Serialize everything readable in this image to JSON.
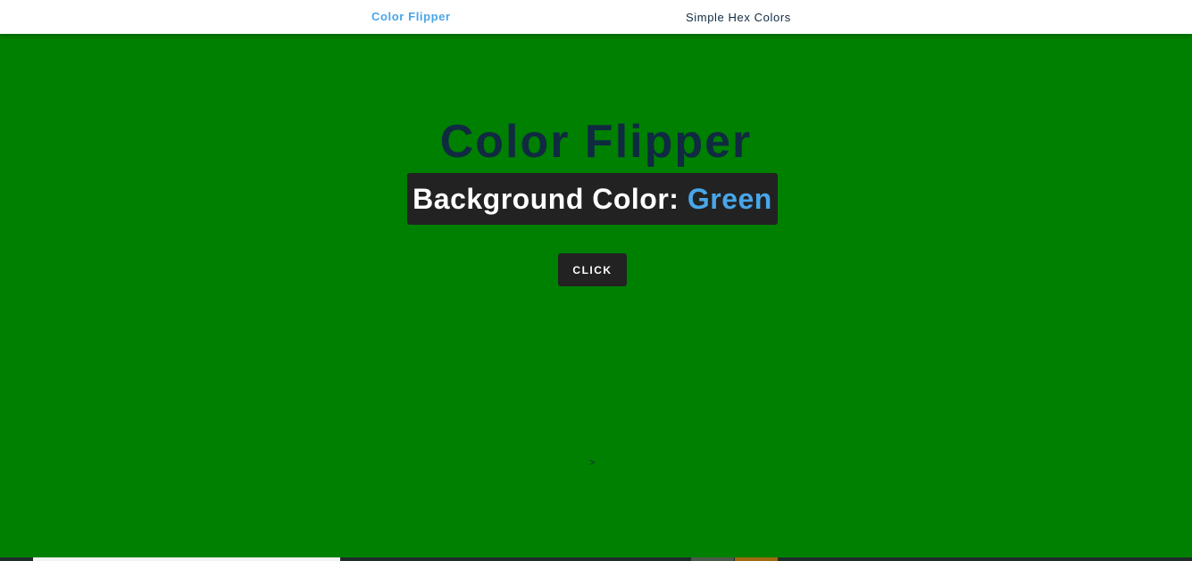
{
  "nav": {
    "brand": "Color Flipper",
    "link_hex": "Simple Hex Colors"
  },
  "main": {
    "title": "Color Flipper",
    "label": "Background Color: ",
    "color_name": "Green",
    "button_label": "CLICK",
    "arrow_text": ">"
  },
  "colors": {
    "background": "#008000",
    "accent": "#49a6e9",
    "title": "#102a42",
    "dark_box": "#222222"
  }
}
